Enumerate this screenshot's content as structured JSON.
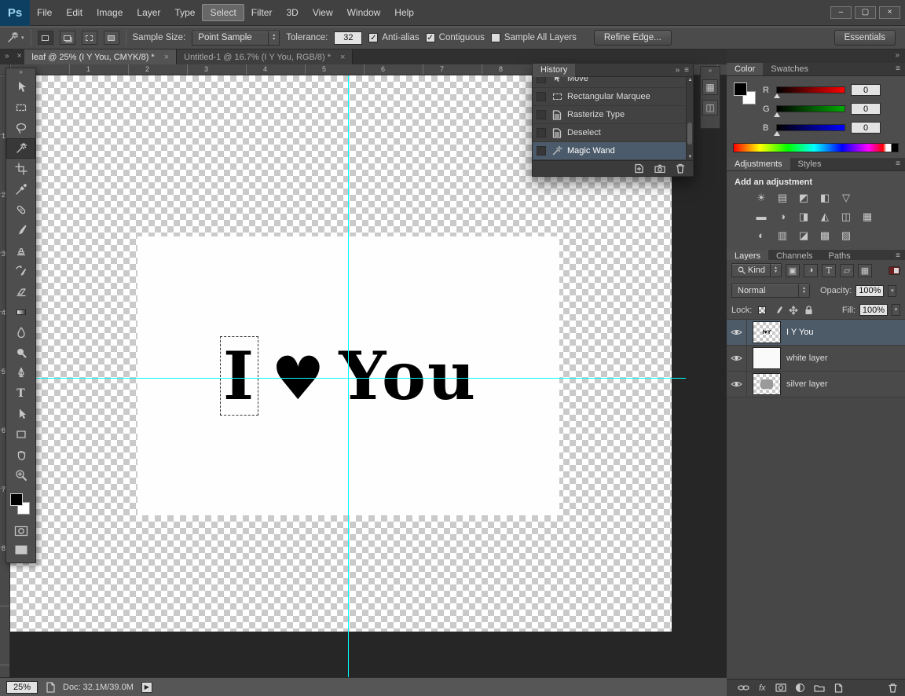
{
  "window": {
    "controls": {
      "minimize": "–",
      "maximize": "▢",
      "close": "×"
    }
  },
  "menu_bar": {
    "logo": "Ps",
    "items": [
      "File",
      "Edit",
      "Image",
      "Layer",
      "Type",
      "Select",
      "Filter",
      "3D",
      "View",
      "Window",
      "Help"
    ],
    "active_item": "Select"
  },
  "options_bar": {
    "sample_size_label": "Sample Size:",
    "sample_size_value": "Point Sample",
    "tolerance_label": "Tolerance:",
    "tolerance_value": "32",
    "anti_alias_label": "Anti-alias",
    "contiguous_label": "Contiguous",
    "sample_all_layers_label": "Sample All Layers",
    "refine_edge_label": "Refine Edge...",
    "workspace_label": "Essentials",
    "checkmark": "✓"
  },
  "document_tabs": [
    {
      "title": "leaf @ 25% (I Y You, CMYK/8) *",
      "close": "×",
      "active": true
    },
    {
      "title": "Untitled-1 @ 16.7% (I Y You, RGB/8) *",
      "close": "×",
      "active": false
    }
  ],
  "toolbox": {
    "tools": [
      "move",
      "rectangular-marquee",
      "lasso",
      "magic-wand",
      "crop",
      "eyedropper",
      "spot-healing-brush",
      "brush",
      "clone-stamp",
      "history-brush",
      "eraser",
      "gradient",
      "blur",
      "dodge",
      "pen",
      "type",
      "path-selection",
      "rectangle",
      "hand",
      "zoom"
    ],
    "selected_tool": "magic-wand"
  },
  "rulers": {
    "horizontal": [
      "1",
      "2",
      "3",
      "4",
      "5",
      "6",
      "7",
      "8"
    ],
    "vertical": [
      "1",
      "2",
      "3",
      "4",
      "5",
      "6",
      "7",
      "8"
    ]
  },
  "canvas": {
    "selected_word": "I",
    "heart": "♥",
    "word": "You"
  },
  "history_panel": {
    "title": "History",
    "items": [
      {
        "label": "Move",
        "selected": false
      },
      {
        "label": "Rectangular Marquee",
        "selected": false
      },
      {
        "label": "Rasterize Type",
        "selected": false
      },
      {
        "label": "Deselect",
        "selected": false
      },
      {
        "label": "Magic Wand",
        "selected": true
      }
    ]
  },
  "color_panel": {
    "tabs": [
      "Color",
      "Swatches"
    ],
    "channels": [
      {
        "label": "R",
        "value": "0"
      },
      {
        "label": "G",
        "value": "0"
      },
      {
        "label": "B",
        "value": "0"
      }
    ]
  },
  "adjustments_panel": {
    "tabs": [
      "Adjustments",
      "Styles"
    ],
    "heading": "Add an adjustment",
    "rows": [
      [
        {
          "name": "brightness-contrast",
          "glyph": "☀"
        },
        {
          "name": "levels",
          "glyph": "▤"
        },
        {
          "name": "curves",
          "glyph": "◩"
        },
        {
          "name": "exposure",
          "glyph": "◧"
        },
        {
          "name": "vibrance",
          "glyph": "▽"
        }
      ],
      [
        {
          "name": "hue-saturation",
          "glyph": "▬"
        },
        {
          "name": "color-balance",
          "glyph": "◑"
        },
        {
          "name": "black-white",
          "glyph": "◨"
        },
        {
          "name": "photo-filter",
          "glyph": "◭"
        },
        {
          "name": "channel-mixer",
          "glyph": "◫"
        },
        {
          "name": "color-lookup",
          "glyph": "▦"
        }
      ],
      [
        {
          "name": "invert",
          "glyph": "◐"
        },
        {
          "name": "posterize",
          "glyph": "▥"
        },
        {
          "name": "threshold",
          "glyph": "◪"
        },
        {
          "name": "gradient-map",
          "glyph": "▩"
        },
        {
          "name": "selective-color",
          "glyph": "▨"
        }
      ]
    ]
  },
  "layers_panel": {
    "tabs": [
      "Layers",
      "Channels",
      "Paths"
    ],
    "kind_label": "Kind",
    "blend_mode": "Normal",
    "opacity_label": "Opacity:",
    "opacity_value": "100%",
    "lock_label": "Lock:",
    "fill_label": "Fill:",
    "fill_value": "100%",
    "layers": [
      {
        "name": "I Y You",
        "selected": true
      },
      {
        "name": "white layer",
        "selected": false
      },
      {
        "name": "silver layer",
        "selected": false
      }
    ]
  },
  "status_bar": {
    "zoom": "25%",
    "doc_info": "Doc: 32.1M/39.0M"
  },
  "colors": {
    "selection_highlight": "#4c5b6b",
    "guide": "#00ffff",
    "checker": "#cacaca"
  }
}
